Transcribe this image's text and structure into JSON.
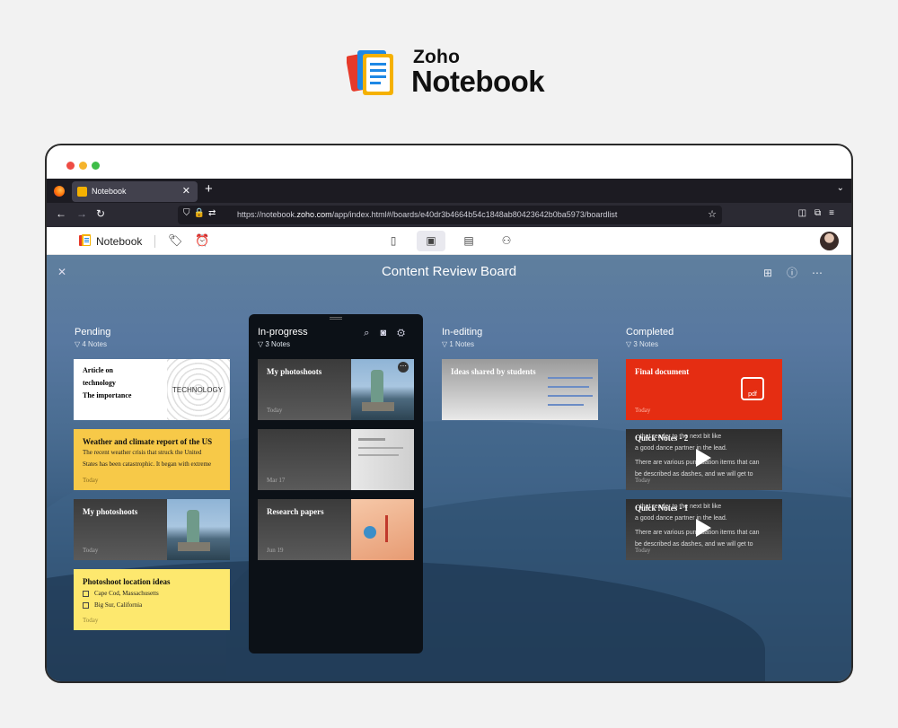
{
  "brand": {
    "line1": "Zoho",
    "line2": "Notebook"
  },
  "browser": {
    "tab_title": "Notebook",
    "url_prefix": "https://notebook.",
    "url_host": "zoho.com",
    "url_rest": "/app/index.html#/boards/e40dr3b4664b54c1848ab80423642b0ba5973/boardlist"
  },
  "app": {
    "name": "Notebook"
  },
  "board": {
    "title": "Content Review Board",
    "columns": [
      {
        "title": "Pending",
        "count": "4 Notes"
      },
      {
        "title": "In-progress",
        "count": "3 Notes"
      },
      {
        "title": "In-editing",
        "count": "1 Notes"
      },
      {
        "title": "Completed",
        "count": "3 Notes"
      }
    ]
  },
  "cards": {
    "pending": [
      {
        "lines": [
          "Article on",
          "technology",
          "The importance"
        ],
        "image_text": "TECHNOLOGY"
      },
      {
        "title": "Weather and climate report of the US",
        "body1": "The recent weather crisis that struck the United",
        "body2": "States has been catastrophic. It began with extreme",
        "date": "Today"
      },
      {
        "title": "My photoshoots",
        "date": "Today"
      },
      {
        "title": "Photoshoot location ideas",
        "item1": "Cape Cod, Massachusetts",
        "item2": "Big Sur, California",
        "date": "Today"
      }
    ],
    "inprogress": [
      {
        "title": "My photoshoots",
        "date": "Today"
      },
      {
        "title": "",
        "date": "Mar 17"
      },
      {
        "title": "Research papers",
        "date": "Jun 19"
      }
    ],
    "inediting": [
      {
        "title": "Ideas shared by students"
      }
    ],
    "completed": [
      {
        "title": "Final document",
        "date": "Today",
        "badge": "pdf"
      },
      {
        "title": "Quick Notes - 2",
        "l1": "...that reader to the next bit like",
        "l2": "a good dance partner in the lead.",
        "l3": "There are various punctuation items that can",
        "l4": "be described as dashes, and we will get to",
        "date": "Today"
      },
      {
        "title": "Quick Notes - 1",
        "l1": "...that reader to the next bit like",
        "l2": "a good dance partner in the lead.",
        "l3": "There are various punctuation items that can",
        "l4": "be described as dashes, and we will get to",
        "date": "Today"
      }
    ]
  },
  "colors": {
    "accent": "#f5b100",
    "yellow_card": "#f7c948",
    "light_yellow_card": "#fde86e",
    "red_card": "#e52d12"
  }
}
